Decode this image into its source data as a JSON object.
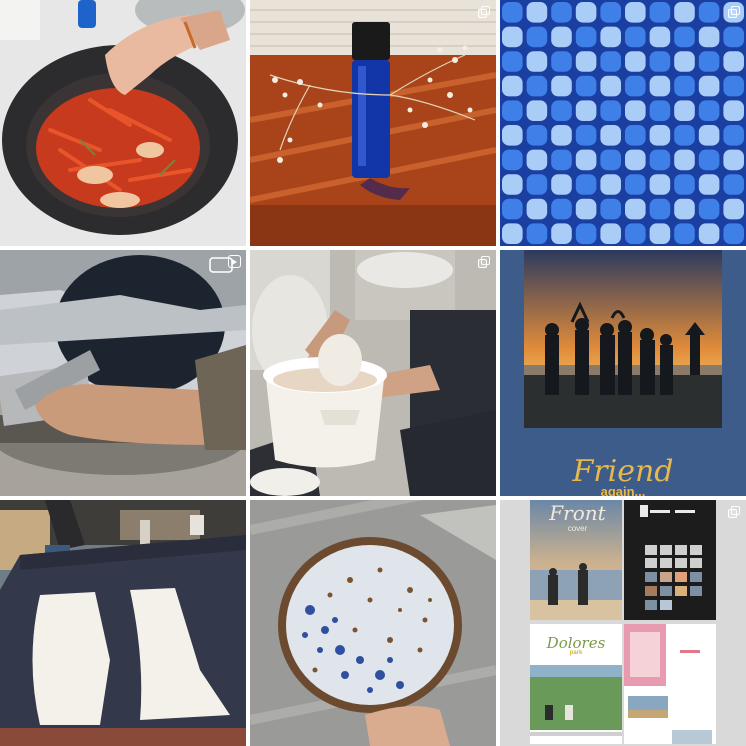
{
  "grid": {
    "posts": [
      {
        "id_name": "kimchi",
        "type": "photo"
      },
      {
        "id_name": "perfume-bottle",
        "type": "multi"
      },
      {
        "id_name": "blue-pattern",
        "type": "multi"
      },
      {
        "id_name": "miter-saw",
        "type": "reel"
      },
      {
        "id_name": "plaster-mold",
        "type": "multi"
      },
      {
        "id_name": "friend-again-poster",
        "type": "photo"
      },
      {
        "id_name": "sewing-pattern",
        "type": "photo"
      },
      {
        "id_name": "ceramic-plate",
        "type": "photo"
      },
      {
        "id_name": "front-cover-layout",
        "type": "multi"
      }
    ]
  },
  "poster": {
    "title": "Friend",
    "subtitle": "again..."
  },
  "layout_board": {
    "front_title": "Front",
    "front_sub": "cover",
    "dolores_title": "Dolores",
    "dolores_sub": "park"
  },
  "colors": {
    "pattern_light": "#a9cdf7",
    "pattern_mid": "#3f7fe8",
    "pattern_dark": "#1b3fa0",
    "poster_bg": "#3d5c8a",
    "poster_accent": "#f0b73e"
  }
}
